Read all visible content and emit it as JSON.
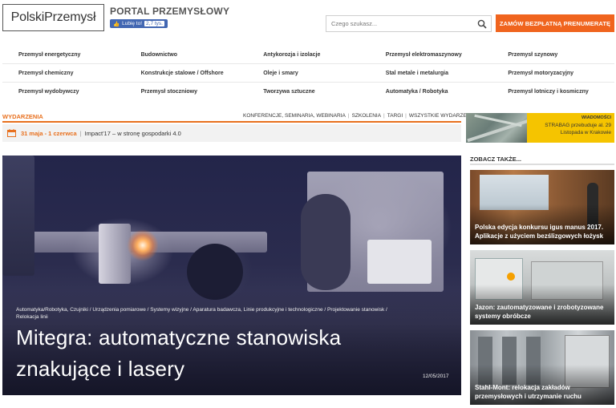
{
  "header": {
    "logo_text": "PolskiPrzemysł",
    "portal_title": "PORTAL PRZEMYSŁOWY",
    "fb_like_label": "Lubię to!",
    "fb_like_count": "2,7 tys.",
    "search_placeholder": "Czego szukasz...",
    "subscribe_label": "ZAMÓW BEZPŁATNĄ PRENUMERATĘ"
  },
  "categories": [
    [
      "Przemysł energetyczny",
      "Budownictwo",
      "Antykorozja i izolacje",
      "Przemysł elektromaszynowy",
      "Przemysł szynowy"
    ],
    [
      "Przemysł chemiczny",
      "Konstrukcje stalowe / Offshore",
      "Oleje i smary",
      "Stal metale i metalurgia",
      "Przemysł motoryzacyjny"
    ],
    [
      "Przemysł wydobywczy",
      "Przemysł stoczniowy",
      "Tworzywa sztuczne",
      "Automatyka / Robotyka",
      "Przemysł lotniczy i kosmiczny"
    ]
  ],
  "events": {
    "label": "WYDARZENIA",
    "links": [
      "KONFERENCJE, SEMINARIA, WEBINARIA",
      "SZKOLENIA",
      "TARGI",
      "WSZYSTKIE WYDARZENIA"
    ],
    "separator": "|",
    "item_date": "31 maja - 1 czerwca",
    "item_title": "Impact'17 – w stronę gospodarki 4.0"
  },
  "ad": {
    "label": "WIADOMOŚCI",
    "title": "STRABAG przebuduje al. 29 Listopada w Krakowie"
  },
  "hero": {
    "categories": "Automatyka/Robotyka, Czujniki / Urządzenia pomiarowe / Systemy wizyjne / Aparatura badawcza, Linie produkcyjne i technologiczne / Projektowanie stanowisk / Relokacja linii",
    "title": "Mitegra: automatyczne stanowiska znakujące i lasery",
    "date": "12/05/2017"
  },
  "sidebar": {
    "heading": "ZOBACZ TAKŻE...",
    "cards": [
      {
        "caption": "Polska edycja konkursu igus manus 2017. Aplikacje z użyciem bezślizgowych łożysk"
      },
      {
        "caption": "Jazon: zautomatyzowane i zrobotyzowane systemy obróbcze"
      },
      {
        "caption": "Stahl-Mont: relokacja zakładów przemysłowych i utrzymanie ruchu"
      }
    ]
  },
  "colors": {
    "accent": "#f0641e",
    "events_orange": "#e8701e",
    "ad_yellow": "#f5c400",
    "fb_blue": "#4267b2"
  }
}
